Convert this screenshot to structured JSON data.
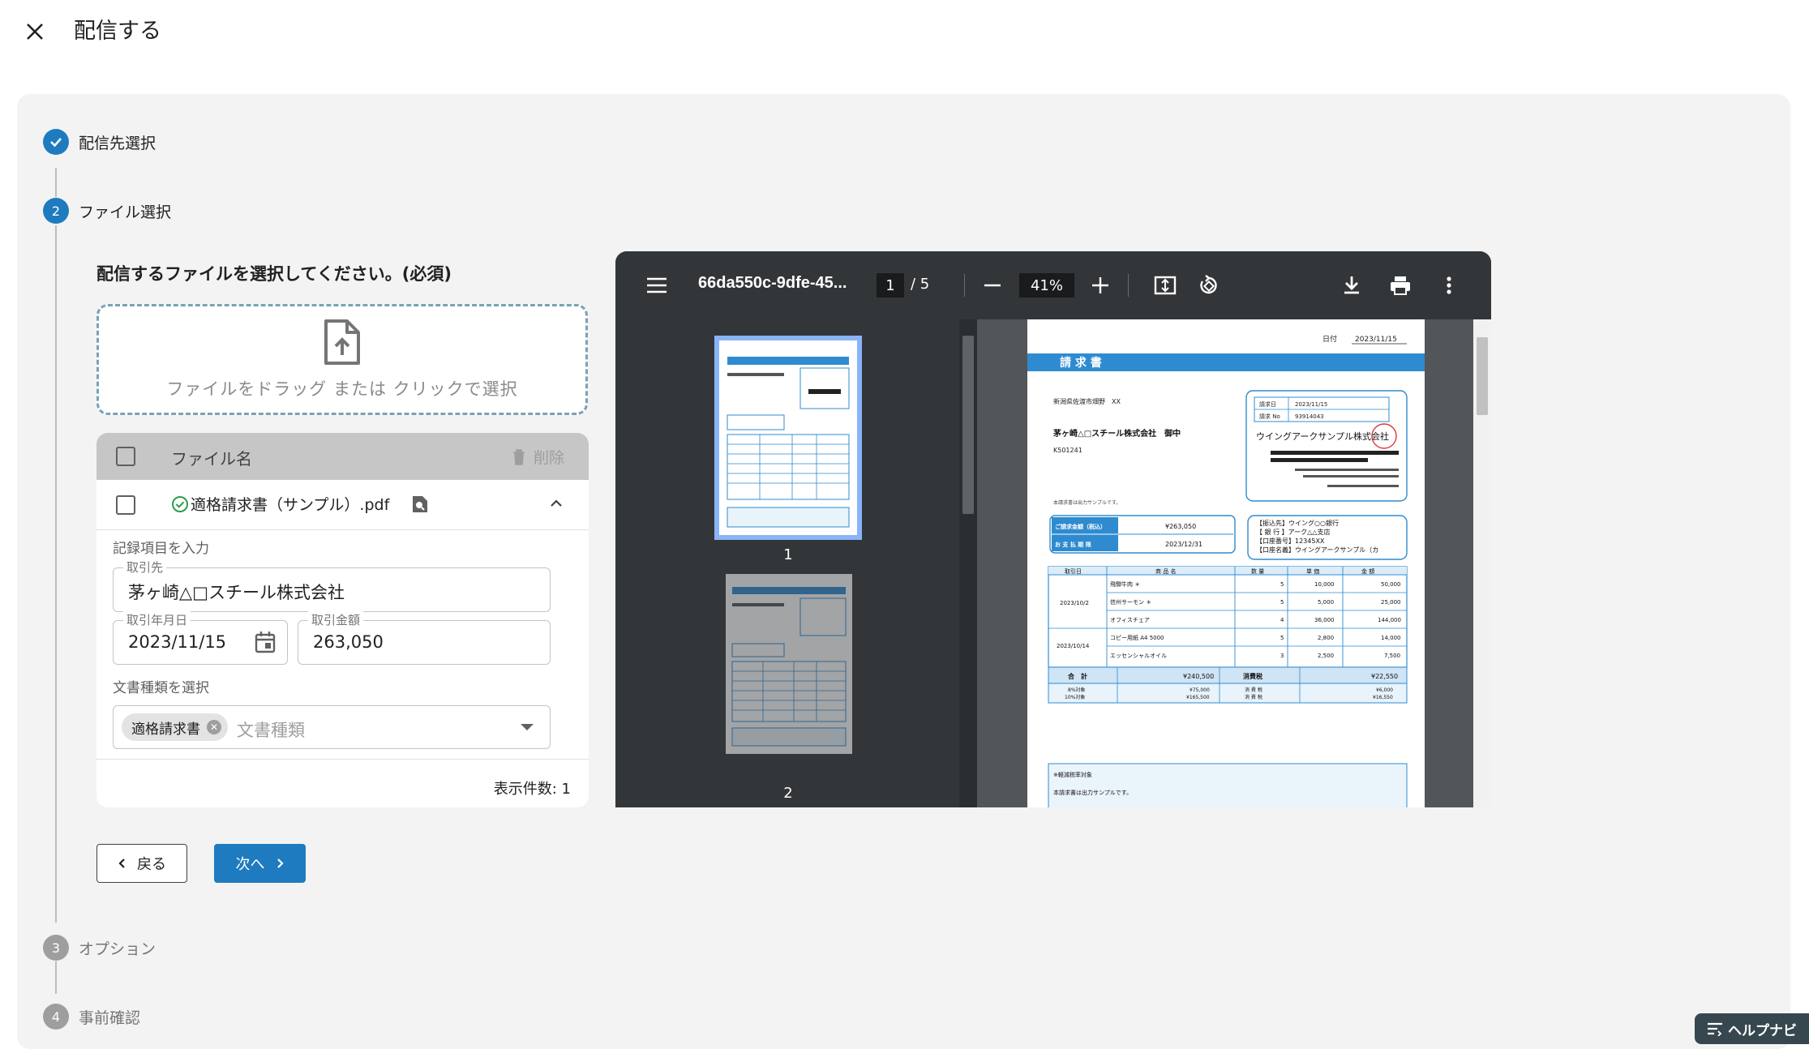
{
  "header": {
    "title": "配信する",
    "close_icon": "close-icon"
  },
  "stepper": {
    "steps": [
      {
        "number": "1",
        "label": "配信先選択",
        "state": "done"
      },
      {
        "number": "2",
        "label": "ファイル選択",
        "state": "active"
      },
      {
        "number": "3",
        "label": "オプション",
        "state": "todo"
      },
      {
        "number": "4",
        "label": "事前確認",
        "state": "todo"
      }
    ]
  },
  "file_step": {
    "title": "配信するファイルを選択してください。(必須)",
    "dropzone_text": "ファイルをドラッグ または クリックで選択",
    "table": {
      "col_name": "ファイル名",
      "delete_label": "削除",
      "rows": [
        {
          "name": "適格請求書（サンプル）.pdf"
        }
      ],
      "count_label": "表示件数: 1"
    },
    "record": {
      "heading": "記録項目を入力",
      "partner_label": "取引先",
      "partner_value": "茅ヶ崎△□スチール株式会社",
      "date_label": "取引年月日",
      "date_value": "2023/11/15",
      "amount_label": "取引金額",
      "amount_value": "263,050",
      "doctype_heading": "文書種類を選択",
      "doctype_chip": "適格請求書",
      "doctype_placeholder": "文書種類"
    },
    "back_label": "戻る",
    "next_label": "次へ"
  },
  "viewer": {
    "filename": "66da550c-9dfe-45...",
    "page": "1",
    "total": "/ 5",
    "zoom": "41%",
    "thumb1": "1",
    "thumb2": "2"
  },
  "invoice": {
    "date_label": "日付",
    "date": "2023/11/15",
    "title": "請 求 書",
    "address": "新潟県佐渡市畑野　XX",
    "customer": "茅ヶ崎△□スチール株式会社　御中",
    "customer_code": "K501241",
    "issue_date_label": "請求日",
    "issue_date": "2023/11/15",
    "invoice_no_label": "請求 No",
    "invoice_no": "93914043",
    "company": "ウイングアークサンプル株式会社",
    "intro": "本請求書は出力サンプルです。",
    "amount_label": "ご請求金額（税込）",
    "amount": "¥263,050",
    "due_label": "お 支 払 期 限",
    "due": "2023/12/31",
    "bank_1": "【振込先】ウイング○○銀行",
    "bank_2": "【 銀 行 】アーク△△支店",
    "bank_3": "【口座番号】12345XX",
    "bank_4": "【口座名義】ウイングアークサンプル（カ",
    "cols": [
      "取引日",
      "商 品 名",
      "数 量",
      "単 価",
      "金 額"
    ],
    "items": [
      {
        "date": "2023/10/2",
        "name": "飛騨牛肉 ＊",
        "qty": "5",
        "price": "10,000",
        "amount": "50,000"
      },
      {
        "date": "",
        "name": "信州サーモン ＊",
        "qty": "5",
        "price": "5,000",
        "amount": "25,000"
      },
      {
        "date": "",
        "name": "オフィスチェア",
        "qty": "4",
        "price": "36,000",
        "amount": "144,000"
      },
      {
        "date": "2023/10/14",
        "name": "コピー用紙 A4 5000",
        "qty": "5",
        "price": "2,800",
        "amount": "14,000"
      },
      {
        "date": "",
        "name": "エッセンシャルオイル",
        "qty": "3",
        "price": "2,500",
        "amount": "7,500"
      }
    ],
    "total_label": "合　計",
    "total": "¥240,500",
    "tax_label": "消費税",
    "tax": "¥22,550",
    "rate8": "8%対象",
    "rate8_amt": "¥75,000",
    "rate10": "10%対象",
    "rate10_amt": "¥165,500",
    "tax_small": "消 費 税",
    "tax8": "¥6,000",
    "tax10": "¥16,550",
    "note1": "※軽減税率対象",
    "note2": "本請求書は出力サンプルです。"
  },
  "helpnavi": {
    "label": "ヘルプナビ"
  },
  "colors": {
    "accent": "#1e7bbf",
    "viewer_toolbar": "#323639",
    "invoice_blue": "#2f8bd0"
  }
}
